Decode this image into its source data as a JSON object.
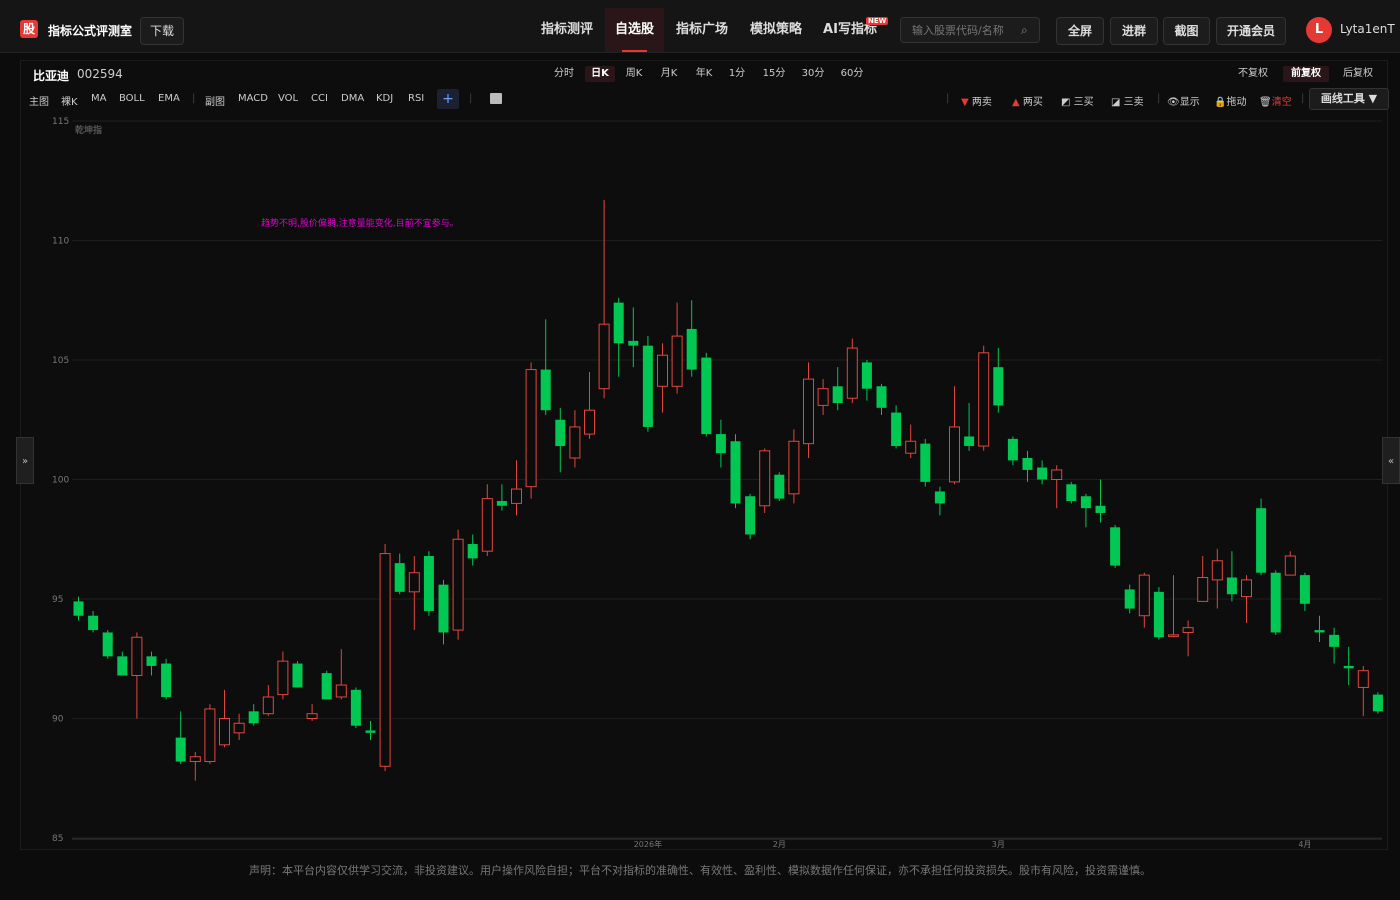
{
  "app": {
    "logo": "股",
    "brand": "指标公式评测室",
    "download_label": "下载",
    "nav": [
      {
        "label": "指标测评"
      },
      {
        "label": "自选股"
      },
      {
        "label": "指标广场"
      },
      {
        "label": "模拟策略"
      },
      {
        "label": "AI写指标"
      }
    ],
    "new_badge": "NEW",
    "search_placeholder": "输入股票代码/名称",
    "buttons": {
      "fullscreen": "全屏",
      "join_group": "进群",
      "screenshot": "截图",
      "vip": "开通会员"
    },
    "user": {
      "avatar_letter": "L",
      "name": "Lyta1enT"
    }
  },
  "stock": {
    "name": "比亚迪",
    "code": "002594"
  },
  "periods": [
    "分时",
    "日K",
    "周K",
    "月K",
    "年K",
    "1分",
    "15分",
    "30分",
    "60分"
  ],
  "active_period": "日K",
  "adjust": [
    "不复权",
    "前复权",
    "后复权"
  ],
  "active_adjust": "前复权",
  "indicators": {
    "main_label": "主图",
    "main": [
      "裸K",
      "MA",
      "BOLL",
      "EMA"
    ],
    "sub_label": "副图",
    "sub": [
      "MACD",
      "VOL",
      "CCI",
      "DMA",
      "KDJ",
      "RSI"
    ],
    "add": "+"
  },
  "tools": {
    "two_sell": "两卖",
    "two_buy": "两买",
    "three_buy": "三买",
    "three_sell": "三卖",
    "show": "显示",
    "drag": "拖动",
    "clear": "清空",
    "draw": "画线工具 ▼"
  },
  "side_toggle_left": "»",
  "side_toggle_right": "«",
  "colors": {
    "up": "#e0473d",
    "down": "#00c853",
    "accent": "#e53935",
    "magenta": "#e000d0"
  },
  "chart_data": {
    "type": "candlestick",
    "indicator_name": "乾坤指",
    "annotation": "趋势不明,股价偏弱,注意量能变化,目前不宜参与。",
    "ylim": [
      85,
      115
    ],
    "yticks": [
      85,
      90,
      95,
      100,
      105,
      110,
      115
    ],
    "grid": true,
    "xticks": [
      {
        "index": 39,
        "label": "2026年"
      },
      {
        "index": 48,
        "label": "2月"
      },
      {
        "index": 63,
        "label": "3月"
      },
      {
        "index": 84,
        "label": "4月"
      }
    ],
    "candles": [
      {
        "o": 94.9,
        "c": 94.3,
        "h": 95.1,
        "l": 94.1
      },
      {
        "o": 94.3,
        "c": 93.7,
        "h": 94.5,
        "l": 93.6
      },
      {
        "o": 93.6,
        "c": 92.6,
        "h": 93.7,
        "l": 92.5
      },
      {
        "o": 92.6,
        "c": 91.8,
        "h": 92.8,
        "l": 91.8
      },
      {
        "o": 91.8,
        "c": 93.4,
        "h": 93.6,
        "l": 90.0
      },
      {
        "o": 92.6,
        "c": 92.2,
        "h": 92.8,
        "l": 91.8
      },
      {
        "o": 92.3,
        "c": 90.9,
        "h": 92.5,
        "l": 90.8
      },
      {
        "o": 89.2,
        "c": 88.2,
        "h": 90.3,
        "l": 88.1
      },
      {
        "o": 88.2,
        "c": 88.4,
        "h": 88.6,
        "l": 87.4
      },
      {
        "o": 88.2,
        "c": 90.4,
        "h": 90.6,
        "l": 88.1
      },
      {
        "o": 88.9,
        "c": 90.0,
        "h": 91.2,
        "l": 88.8
      },
      {
        "o": 89.4,
        "c": 89.8,
        "h": 90.2,
        "l": 89.1
      },
      {
        "o": 90.3,
        "c": 89.8,
        "h": 90.6,
        "l": 89.7
      },
      {
        "o": 90.2,
        "c": 90.9,
        "h": 91.4,
        "l": 90.1
      },
      {
        "o": 91.0,
        "c": 92.4,
        "h": 92.8,
        "l": 90.8
      },
      {
        "o": 92.3,
        "c": 91.3,
        "h": 92.4,
        "l": 91.3
      },
      {
        "o": 90.0,
        "c": 90.2,
        "h": 90.6,
        "l": 89.9
      },
      {
        "o": 91.9,
        "c": 90.8,
        "h": 92.0,
        "l": 90.8
      },
      {
        "o": 90.9,
        "c": 91.4,
        "h": 92.9,
        "l": 90.8
      },
      {
        "o": 91.2,
        "c": 89.7,
        "h": 91.3,
        "l": 89.6
      },
      {
        "o": 89.5,
        "c": 89.4,
        "h": 89.9,
        "l": 89.1
      },
      {
        "o": 88.0,
        "c": 96.9,
        "h": 97.3,
        "l": 87.8
      },
      {
        "o": 96.5,
        "c": 95.3,
        "h": 96.9,
        "l": 95.2
      },
      {
        "o": 95.3,
        "c": 96.1,
        "h": 96.8,
        "l": 93.7
      },
      {
        "o": 96.8,
        "c": 94.5,
        "h": 97.0,
        "l": 94.3
      },
      {
        "o": 95.6,
        "c": 93.6,
        "h": 95.8,
        "l": 93.1
      },
      {
        "o": 93.7,
        "c": 97.5,
        "h": 97.9,
        "l": 93.3
      },
      {
        "o": 97.3,
        "c": 96.7,
        "h": 97.7,
        "l": 96.4
      },
      {
        "o": 97.0,
        "c": 99.2,
        "h": 99.8,
        "l": 96.8
      },
      {
        "o": 99.1,
        "c": 98.9,
        "h": 99.8,
        "l": 98.7
      },
      {
        "o": 99.0,
        "c": 99.6,
        "h": 100.8,
        "l": 98.5
      },
      {
        "o": 99.7,
        "c": 104.6,
        "h": 104.9,
        "l": 99.2
      },
      {
        "o": 104.6,
        "c": 102.9,
        "h": 106.7,
        "l": 102.7
      },
      {
        "o": 102.5,
        "c": 101.4,
        "h": 103.0,
        "l": 100.3
      },
      {
        "o": 100.9,
        "c": 102.2,
        "h": 102.9,
        "l": 100.5
      },
      {
        "o": 101.9,
        "c": 102.9,
        "h": 104.5,
        "l": 101.7
      },
      {
        "o": 103.8,
        "c": 106.5,
        "h": 111.7,
        "l": 103.4
      },
      {
        "o": 107.4,
        "c": 105.7,
        "h": 107.6,
        "l": 104.3
      },
      {
        "o": 105.8,
        "c": 105.6,
        "h": 107.2,
        "l": 104.7
      },
      {
        "o": 105.6,
        "c": 102.2,
        "h": 106.0,
        "l": 102.0
      },
      {
        "o": 103.9,
        "c": 105.2,
        "h": 105.7,
        "l": 102.8
      },
      {
        "o": 103.9,
        "c": 106.0,
        "h": 107.4,
        "l": 103.6
      },
      {
        "o": 106.3,
        "c": 104.6,
        "h": 107.5,
        "l": 104.3
      },
      {
        "o": 105.1,
        "c": 101.9,
        "h": 105.3,
        "l": 101.8
      },
      {
        "o": 101.9,
        "c": 101.1,
        "h": 102.5,
        "l": 100.5
      },
      {
        "o": 101.6,
        "c": 99.0,
        "h": 101.9,
        "l": 98.8
      },
      {
        "o": 99.3,
        "c": 97.7,
        "h": 99.4,
        "l": 97.5
      },
      {
        "o": 98.9,
        "c": 101.2,
        "h": 101.3,
        "l": 98.6
      },
      {
        "o": 100.2,
        "c": 99.2,
        "h": 100.3,
        "l": 99.1
      },
      {
        "o": 99.4,
        "c": 101.6,
        "h": 102.1,
        "l": 99.0
      },
      {
        "o": 101.5,
        "c": 104.2,
        "h": 104.9,
        "l": 100.9
      },
      {
        "o": 103.1,
        "c": 103.8,
        "h": 104.2,
        "l": 102.7
      },
      {
        "o": 103.9,
        "c": 103.2,
        "h": 104.7,
        "l": 102.9
      },
      {
        "o": 103.4,
        "c": 105.5,
        "h": 105.9,
        "l": 103.2
      },
      {
        "o": 104.9,
        "c": 103.8,
        "h": 105.0,
        "l": 103.3
      },
      {
        "o": 103.9,
        "c": 103.0,
        "h": 104.0,
        "l": 102.7
      },
      {
        "o": 102.8,
        "c": 101.4,
        "h": 103.1,
        "l": 101.3
      },
      {
        "o": 101.1,
        "c": 101.6,
        "h": 102.3,
        "l": 100.9
      },
      {
        "o": 101.5,
        "c": 99.9,
        "h": 101.7,
        "l": 99.7
      },
      {
        "o": 99.5,
        "c": 99.0,
        "h": 99.7,
        "l": 98.5
      },
      {
        "o": 99.9,
        "c": 102.2,
        "h": 103.9,
        "l": 99.8
      },
      {
        "o": 101.8,
        "c": 101.4,
        "h": 103.2,
        "l": 101.2
      },
      {
        "o": 101.4,
        "c": 105.3,
        "h": 105.6,
        "l": 101.2
      },
      {
        "o": 104.7,
        "c": 103.1,
        "h": 105.5,
        "l": 102.8
      },
      {
        "o": 101.7,
        "c": 100.8,
        "h": 101.8,
        "l": 100.6
      },
      {
        "o": 100.9,
        "c": 100.4,
        "h": 101.2,
        "l": 99.9
      },
      {
        "o": 100.5,
        "c": 100.0,
        "h": 100.8,
        "l": 99.8
      },
      {
        "o": 100.0,
        "c": 100.4,
        "h": 100.6,
        "l": 98.8
      },
      {
        "o": 99.8,
        "c": 99.1,
        "h": 99.9,
        "l": 99.0
      },
      {
        "o": 99.3,
        "c": 98.8,
        "h": 99.4,
        "l": 98.0
      },
      {
        "o": 98.9,
        "c": 98.6,
        "h": 100.0,
        "l": 98.2
      },
      {
        "o": 98.0,
        "c": 96.4,
        "h": 98.1,
        "l": 96.3
      },
      {
        "o": 95.4,
        "c": 94.6,
        "h": 95.6,
        "l": 94.4
      },
      {
        "o": 94.3,
        "c": 96.0,
        "h": 96.1,
        "l": 93.8
      },
      {
        "o": 95.3,
        "c": 93.4,
        "h": 95.5,
        "l": 93.3
      },
      {
        "o": 93.5,
        "c": 93.5,
        "h": 96.0,
        "l": 93.4
      },
      {
        "o": 93.6,
        "c": 93.8,
        "h": 94.1,
        "l": 92.6
      },
      {
        "o": 94.9,
        "c": 95.9,
        "h": 96.8,
        "l": 94.9
      },
      {
        "o": 95.8,
        "c": 96.6,
        "h": 97.1,
        "l": 94.6
      },
      {
        "o": 95.9,
        "c": 95.2,
        "h": 97.0,
        "l": 94.9
      },
      {
        "o": 95.1,
        "c": 95.8,
        "h": 96.0,
        "l": 94.0
      },
      {
        "o": 98.8,
        "c": 96.1,
        "h": 99.2,
        "l": 96.0
      },
      {
        "o": 96.1,
        "c": 93.6,
        "h": 96.2,
        "l": 93.5
      },
      {
        "o": 96.0,
        "c": 96.8,
        "h": 97.0,
        "l": 96.1
      },
      {
        "o": 96.0,
        "c": 94.8,
        "h": 96.1,
        "l": 94.5
      },
      {
        "o": 93.7,
        "c": 93.6,
        "h": 94.3,
        "l": 93.2
      },
      {
        "o": 93.5,
        "c": 93.0,
        "h": 93.8,
        "l": 92.3
      },
      {
        "o": 92.2,
        "c": 92.1,
        "h": 93.0,
        "l": 91.4
      },
      {
        "o": 91.3,
        "c": 92.0,
        "h": 92.2,
        "l": 90.1
      },
      {
        "o": 91.0,
        "c": 90.3,
        "h": 91.1,
        "l": 90.2
      }
    ]
  },
  "footer": "声明：本平台内容仅供学习交流，非投资建议。用户操作风险自担；平台不对指标的准确性、有效性、盈利性、模拟数据作任何保证，亦不承担任何投资损失。股市有风险，投资需谨慎。"
}
